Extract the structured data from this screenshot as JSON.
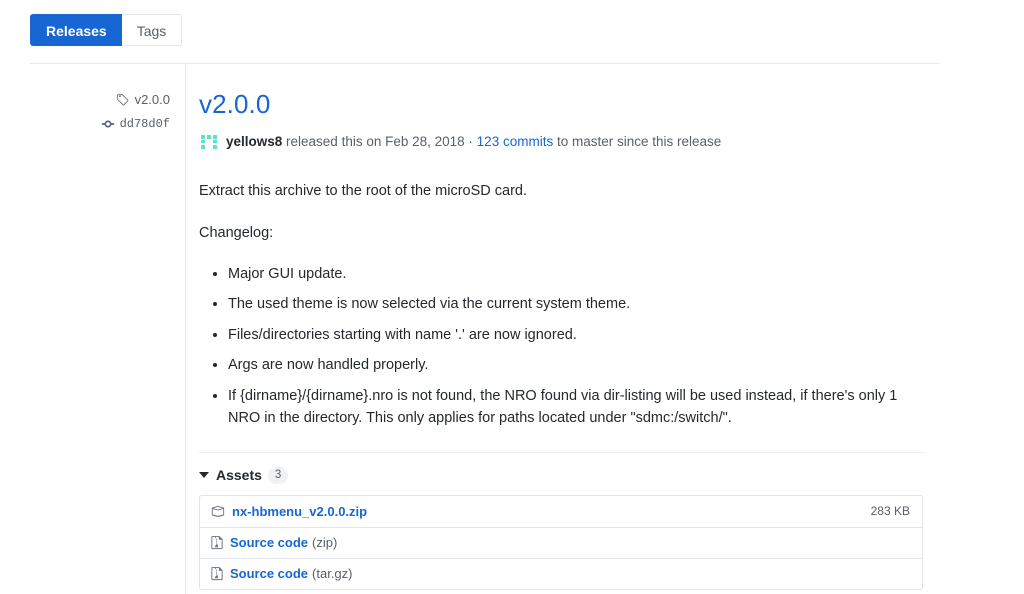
{
  "tabs": [
    {
      "label": "Releases",
      "active": true,
      "name": "tab-releases"
    },
    {
      "label": "Tags",
      "active": false,
      "name": "tab-tags"
    }
  ],
  "meta": {
    "tag_icon": "tag-icon",
    "tag_label": "v2.0.0",
    "commit_icon": "git-commit-icon",
    "commit_hash": "dd78d0f"
  },
  "release": {
    "title": "v2.0.0",
    "author": "yellows8",
    "byline_released": " released this on ",
    "date": "Feb 28, 2018",
    "byline_dot": " · ",
    "commits_link": "123 commits",
    "byline_tail": " to master since this release",
    "avatar_icon": "avatar-identicon"
  },
  "body": {
    "intro": "Extract this archive to the root of the microSD card.",
    "changelog_heading": "Changelog:",
    "changelog": [
      "Major GUI update.",
      "The used theme is now selected via the current system theme.",
      "Files/directories starting with name '.' are now ignored.",
      "Args are now handled properly.",
      "If {dirname}/{dirname}.nro is not found, the NRO found via dir-listing will be used instead, if there's only 1 NRO in the directory. This only applies for paths located under \"sdmc:/switch/\"."
    ]
  },
  "assets": {
    "label": "Assets",
    "count": "3",
    "caret_icon": "caret-down-icon",
    "items": [
      {
        "icon": "package-icon",
        "name": "nx-hbmenu_v2.0.0.zip",
        "ext": "",
        "size": "283 KB"
      },
      {
        "icon": "file-zip-icon",
        "name": "Source code",
        "ext": "(zip)",
        "size": ""
      },
      {
        "icon": "file-zip-icon",
        "name": "Source code",
        "ext": "(tar.gz)",
        "size": ""
      }
    ]
  },
  "colors": {
    "accent_blue": "#1766d4",
    "text": "#24292e",
    "muted": "#586069",
    "border": "#e1e4e8",
    "avatar_teal": "#5fe3c8"
  }
}
